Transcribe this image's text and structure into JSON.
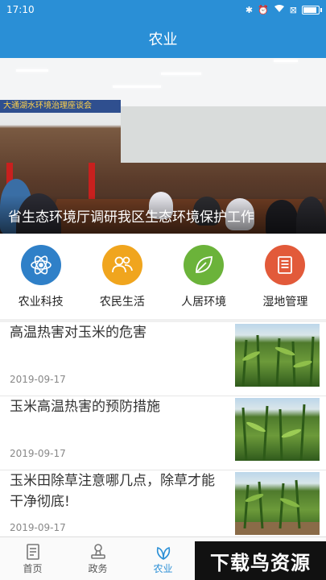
{
  "status_bar": {
    "time": "17:10"
  },
  "header": {
    "title": "农业"
  },
  "banner": {
    "caption": "省生态环境厅调研我区生态环境保护工作",
    "sign_text": "大通湖水环境治理座谈会"
  },
  "categories": [
    {
      "label": "农业科技",
      "icon": "atom-icon",
      "color": "#2f80c8"
    },
    {
      "label": "农民生活",
      "icon": "people-icon",
      "color": "#f0a51e"
    },
    {
      "label": "人居环境",
      "icon": "leaf-icon",
      "color": "#6bb33a"
    },
    {
      "label": "湿地管理",
      "icon": "document-icon",
      "color": "#e25a3a"
    }
  ],
  "news": [
    {
      "title": "高温热害对玉米的危害",
      "date": "2019-09-17"
    },
    {
      "title": "玉米高温热害的预防措施",
      "date": "2019-09-17"
    },
    {
      "title": "玉米田除草注意哪几点，除草才能干净彻底!",
      "date": "2019-09-17"
    }
  ],
  "tabs": [
    {
      "label": "首页",
      "icon": "home-icon"
    },
    {
      "label": "政务",
      "icon": "stamp-icon"
    },
    {
      "label": "农业",
      "icon": "leaf-icon",
      "active": true
    }
  ],
  "watermark": {
    "text": "下载鸟资源"
  },
  "colors": {
    "primary": "#2a8fd6"
  }
}
